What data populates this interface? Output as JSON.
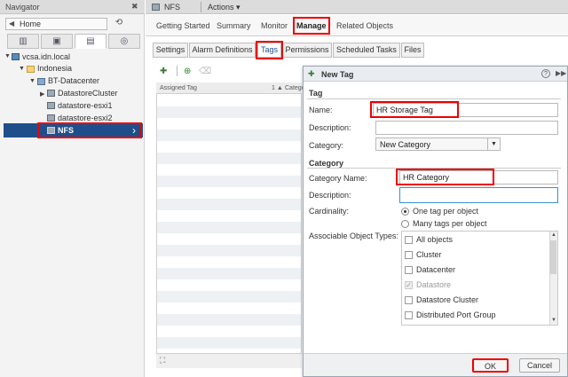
{
  "navigator": {
    "title": "Navigator",
    "home_label": "Home",
    "icons": [
      "hosts-icon",
      "vms-icon",
      "storage-icon",
      "network-icon"
    ],
    "tree": {
      "vcenter": "vcsa.idn.local",
      "folder": "Indonesia",
      "datacenter": "BT-Datacenter",
      "items": [
        "DatastoreCluster",
        "datastore-esxi1",
        "datastore-esxi2"
      ],
      "selected": "NFS"
    }
  },
  "object": {
    "name": "NFS",
    "actions_label": "Actions ▾"
  },
  "main_tabs": [
    "Getting Started",
    "Summary",
    "Monitor",
    "Manage",
    "Related Objects"
  ],
  "sub_tabs": [
    "Settings",
    "Alarm Definitions",
    "Tags",
    "Permissions",
    "Scheduled Tasks",
    "Files"
  ],
  "tag_list": {
    "col_assigned": "Assigned Tag",
    "sort_indicator": "1 ▲",
    "col_category": "Catego"
  },
  "dialog": {
    "title": "New Tag",
    "tag_section": "Tag",
    "name_label": "Name:",
    "name_value": "HR Storage Tag",
    "desc_label": "Description:",
    "desc_value": "",
    "category_label": "Category:",
    "category_value": "New Category",
    "category_section": "Category",
    "cat_name_label": "Category Name:",
    "cat_name_value": "HR Category",
    "cat_desc_label": "Description:",
    "cat_desc_value": "",
    "cardinality_label": "Cardinality:",
    "cardinality_one": "One tag per object",
    "cardinality_many": "Many tags per object",
    "associable_label": "Associable Object Types:",
    "object_types": [
      "All objects",
      "Cluster",
      "Datacenter",
      "Datastore",
      "Datastore Cluster",
      "Distributed Port Group"
    ],
    "ok_label": "OK",
    "cancel_label": "Cancel"
  },
  "colors": {
    "selection": "#1f4f8b",
    "highlight": "#ff0000",
    "focus": "#3b8fd6"
  }
}
